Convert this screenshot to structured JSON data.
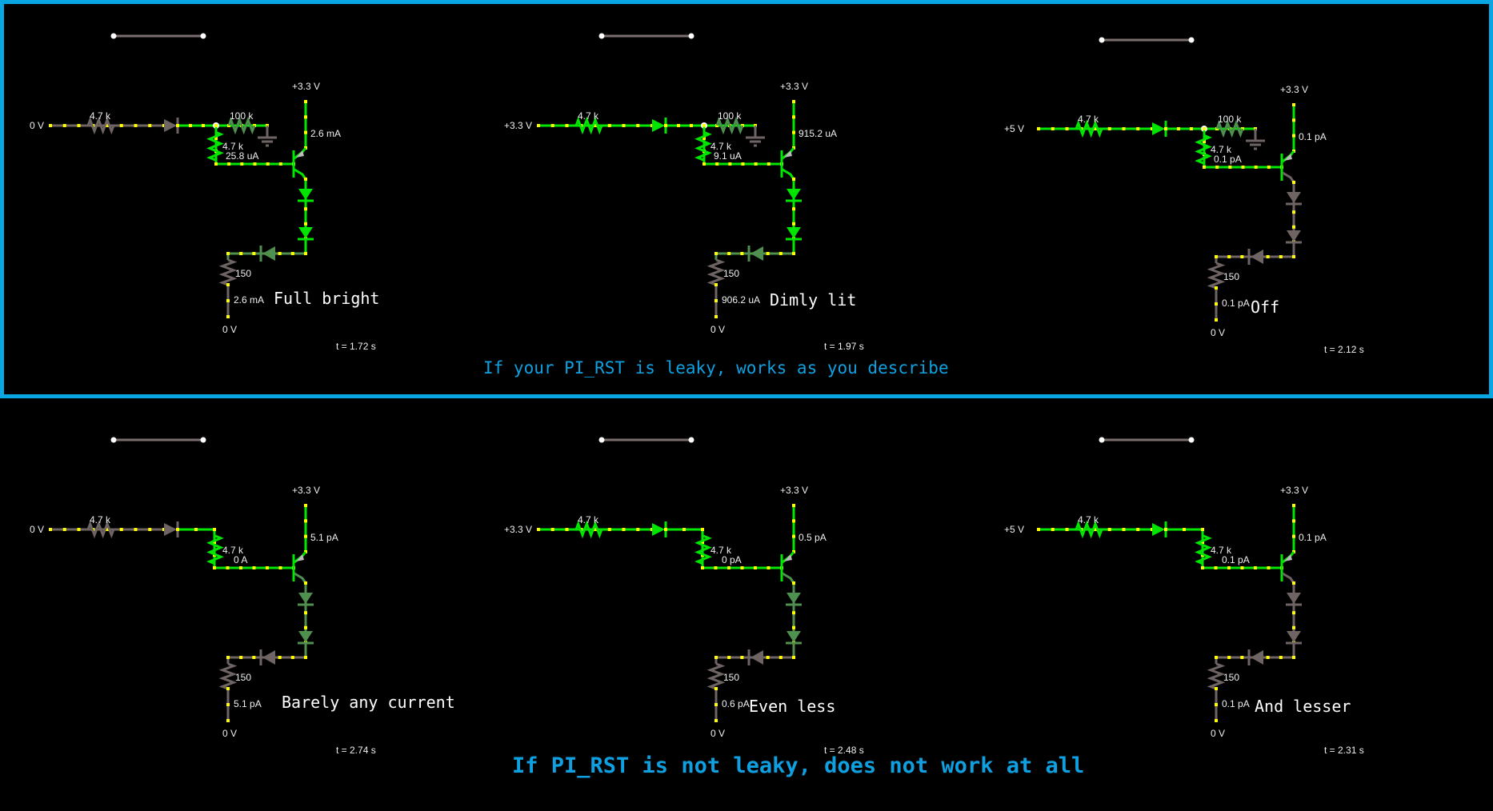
{
  "colors": {
    "accent": "#0aa5e3",
    "wire_on": "#00e600",
    "wire_dim": "#4f8f4f",
    "wire_off": "#6f6464",
    "dot": "#ffff00",
    "text": "#f0f0f0"
  },
  "captions": {
    "top": "If your PI_RST is leaky, works as you describe",
    "bottom": "If PI_RST is not leaky, does not work at all"
  },
  "circuits": [
    {
      "id": "top-1",
      "row": "top",
      "input_voltage": "0 V",
      "input_res": "4.7 k",
      "pulldown_res": "100 k",
      "base_res": "4.7 k",
      "base_current": "25.8 uA",
      "supply": "+3.3 V",
      "collector_current": "2.6 mA",
      "led_res": "150",
      "led_current": "2.6 mA",
      "ground": "0 V",
      "note": "Full bright",
      "time": "t = 1.72 s",
      "state": {
        "input": "off",
        "base": "on",
        "pulldown": "mixed",
        "emitter": "on",
        "leds": "on",
        "led3": "dim",
        "out": "off"
      }
    },
    {
      "id": "top-2",
      "row": "top",
      "input_voltage": "+3.3 V",
      "input_res": "4.7 k",
      "pulldown_res": "100 k",
      "base_res": "4.7 k",
      "base_current": "9.1 uA",
      "supply": "+3.3 V",
      "collector_current": "915.2 uA",
      "led_res": "150",
      "led_current": "906.2 uA",
      "ground": "0 V",
      "note": "Dimly lit",
      "time": "t = 1.97 s",
      "state": {
        "input": "on",
        "base": "on",
        "pulldown": "mixed",
        "emitter": "on",
        "leds": "on",
        "led3": "dim",
        "out": "off"
      }
    },
    {
      "id": "top-3",
      "row": "top",
      "input_voltage": "+5 V",
      "input_res": "4.7 k",
      "pulldown_res": "100 k",
      "base_res": "4.7 k",
      "base_current": "0.1 pA",
      "supply": "+3.3 V",
      "collector_current": "0.1 pA",
      "led_res": "150",
      "led_current": "0.1 pA",
      "ground": "0 V",
      "note": "Off",
      "time": "t = 2.12 s",
      "state": {
        "input": "on",
        "base": "on",
        "pulldown": "mixed",
        "emitter": "off",
        "leds": "off",
        "led3": "off",
        "out": "off"
      }
    },
    {
      "id": "bottom-1",
      "row": "bottom",
      "input_voltage": "0 V",
      "input_res": "4.7 k",
      "base_res": "4.7 k",
      "base_current": "0 A",
      "supply": "+3.3 V",
      "collector_current": "5.1 pA",
      "led_res": "150",
      "led_current": "5.1 pA",
      "ground": "0 V",
      "note": "Barely any current",
      "time": "t = 2.74 s",
      "state": {
        "input": "off",
        "base": "on",
        "emitter": "dim",
        "leds": "dim",
        "led3": "off",
        "out": "off"
      }
    },
    {
      "id": "bottom-2",
      "row": "bottom",
      "input_voltage": "+3.3 V",
      "input_res": "4.7 k",
      "base_res": "4.7 k",
      "base_current": "0 pA",
      "supply": "+3.3 V",
      "collector_current": "0.5 pA",
      "led_res": "150",
      "led_current": "0.6 pA",
      "ground": "0 V",
      "note": "Even less",
      "time": "t = 2.48 s",
      "state": {
        "input": "on",
        "base": "on",
        "emitter": "dim",
        "leds": "dim",
        "led3": "off",
        "out": "off"
      }
    },
    {
      "id": "bottom-3",
      "row": "bottom",
      "input_voltage": "+5 V",
      "input_res": "4.7 k",
      "base_res": "4.7 k",
      "base_current": "0.1 pA",
      "supply": "+3.3 V",
      "collector_current": "0.1 pA",
      "led_res": "150",
      "led_current": "0.1 pA",
      "ground": "0 V",
      "note": "And lesser",
      "time": "t = 2.31 s",
      "state": {
        "input": "on",
        "base": "on",
        "emitter": "off",
        "leds": "off",
        "led3": "off",
        "out": "off"
      }
    }
  ]
}
